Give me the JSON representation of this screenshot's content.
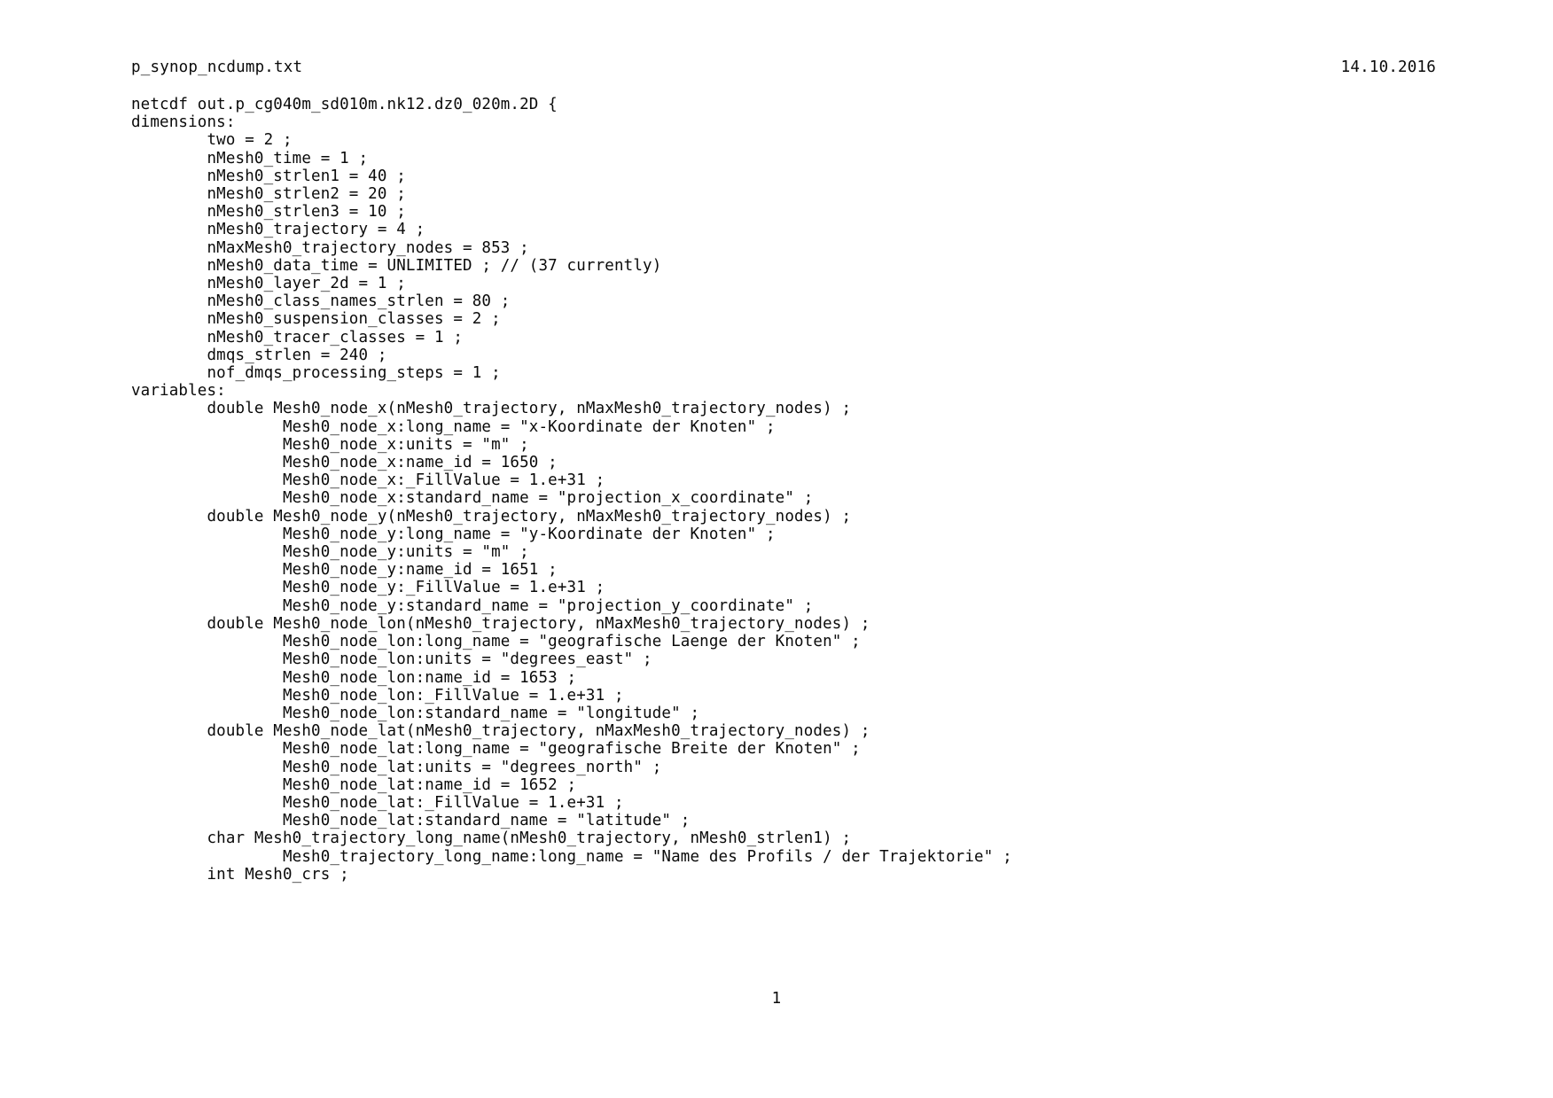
{
  "header": {
    "filename": "p_synop_ncdump.txt",
    "date": "14.10.2016"
  },
  "footer": {
    "page_number": "1"
  },
  "document": {
    "lines": [
      "netcdf out.p_cg040m_sd010m.nk12.dz0_020m.2D {",
      "dimensions:",
      "        two = 2 ;",
      "        nMesh0_time = 1 ;",
      "        nMesh0_strlen1 = 40 ;",
      "        nMesh0_strlen2 = 20 ;",
      "        nMesh0_strlen3 = 10 ;",
      "        nMesh0_trajectory = 4 ;",
      "        nMaxMesh0_trajectory_nodes = 853 ;",
      "        nMesh0_data_time = UNLIMITED ; // (37 currently)",
      "        nMesh0_layer_2d = 1 ;",
      "        nMesh0_class_names_strlen = 80 ;",
      "        nMesh0_suspension_classes = 2 ;",
      "        nMesh0_tracer_classes = 1 ;",
      "        dmqs_strlen = 240 ;",
      "        nof_dmqs_processing_steps = 1 ;",
      "variables:",
      "        double Mesh0_node_x(nMesh0_trajectory, nMaxMesh0_trajectory_nodes) ;",
      "                Mesh0_node_x:long_name = \"x-Koordinate der Knoten\" ;",
      "                Mesh0_node_x:units = \"m\" ;",
      "                Mesh0_node_x:name_id = 1650 ;",
      "                Mesh0_node_x:_FillValue = 1.e+31 ;",
      "                Mesh0_node_x:standard_name = \"projection_x_coordinate\" ;",
      "        double Mesh0_node_y(nMesh0_trajectory, nMaxMesh0_trajectory_nodes) ;",
      "                Mesh0_node_y:long_name = \"y-Koordinate der Knoten\" ;",
      "                Mesh0_node_y:units = \"m\" ;",
      "                Mesh0_node_y:name_id = 1651 ;",
      "                Mesh0_node_y:_FillValue = 1.e+31 ;",
      "                Mesh0_node_y:standard_name = \"projection_y_coordinate\" ;",
      "        double Mesh0_node_lon(nMesh0_trajectory, nMaxMesh0_trajectory_nodes) ;",
      "                Mesh0_node_lon:long_name = \"geografische Laenge der Knoten\" ;",
      "                Mesh0_node_lon:units = \"degrees_east\" ;",
      "                Mesh0_node_lon:name_id = 1653 ;",
      "                Mesh0_node_lon:_FillValue = 1.e+31 ;",
      "                Mesh0_node_lon:standard_name = \"longitude\" ;",
      "        double Mesh0_node_lat(nMesh0_trajectory, nMaxMesh0_trajectory_nodes) ;",
      "                Mesh0_node_lat:long_name = \"geografische Breite der Knoten\" ;",
      "                Mesh0_node_lat:units = \"degrees_north\" ;",
      "                Mesh0_node_lat:name_id = 1652 ;",
      "                Mesh0_node_lat:_FillValue = 1.e+31 ;",
      "                Mesh0_node_lat:standard_name = \"latitude\" ;",
      "        char Mesh0_trajectory_long_name(nMesh0_trajectory, nMesh0_strlen1) ;",
      "                Mesh0_trajectory_long_name:long_name = \"Name des Profils / der Trajektorie\" ;",
      "        int Mesh0_crs ;"
    ]
  }
}
